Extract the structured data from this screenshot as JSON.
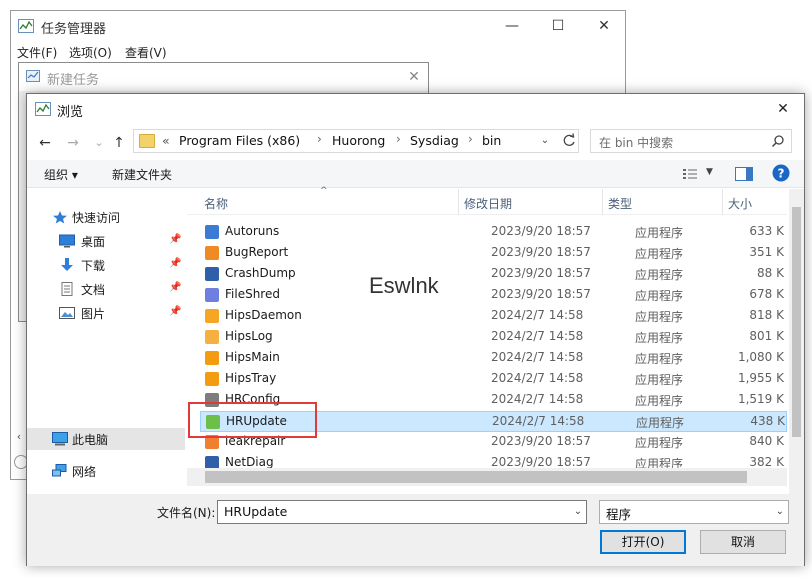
{
  "task_manager": {
    "title": "任务管理器",
    "menu": [
      "文件(F)",
      "选项(O)",
      "查看(V)"
    ],
    "minimize": "—",
    "maximize": "☐",
    "close": "✕"
  },
  "new_task": {
    "title": "新建任务",
    "close": "✕"
  },
  "browse": {
    "title": "浏览",
    "close": "✕",
    "nav": {
      "back": "←",
      "forward": "→",
      "recent": "⌄",
      "up": "↑"
    },
    "address": {
      "prefix": "«",
      "crumbs": [
        "Program Files (x86)",
        "Huorong",
        "Sysdiag",
        "bin"
      ],
      "separator": "›",
      "dropdown": "⌄"
    },
    "search_placeholder": "在 bin 中搜索",
    "toolbar": {
      "organize": "组织 ▾",
      "new_folder": "新建文件夹"
    },
    "nav_pane": [
      {
        "label": "快速访问",
        "icon": "star-icon",
        "pinned": false,
        "selected": false
      },
      {
        "label": "桌面",
        "icon": "desktop-icon",
        "pinned": true,
        "selected": false
      },
      {
        "label": "下载",
        "icon": "download-icon",
        "pinned": true,
        "selected": false
      },
      {
        "label": "文档",
        "icon": "document-icon",
        "pinned": true,
        "selected": false
      },
      {
        "label": "图片",
        "icon": "picture-icon",
        "pinned": true,
        "selected": false
      },
      {
        "label": "此电脑",
        "icon": "computer-icon",
        "pinned": false,
        "selected": true
      },
      {
        "label": "网络",
        "icon": "network-icon",
        "pinned": false,
        "selected": false
      }
    ],
    "columns": {
      "name": "名称",
      "modified": "修改日期",
      "type": "类型",
      "size": "大小"
    },
    "files": [
      {
        "name": "Autoruns",
        "modified": "2023/9/20 18:57",
        "type": "应用程序",
        "size": "633 K",
        "icon": "autoruns-icon",
        "color": "#3b7bd4"
      },
      {
        "name": "BugReport",
        "modified": "2023/9/20 18:57",
        "type": "应用程序",
        "size": "351 K",
        "icon": "bugreport-icon",
        "color": "#f08a24"
      },
      {
        "name": "CrashDump",
        "modified": "2023/9/20 18:57",
        "type": "应用程序",
        "size": "88 K",
        "icon": "crashdump-icon",
        "color": "#2e5fa8"
      },
      {
        "name": "FileShred",
        "modified": "2023/9/20 18:57",
        "type": "应用程序",
        "size": "678 K",
        "icon": "fileshred-icon",
        "color": "#6f7fe0"
      },
      {
        "name": "HipsDaemon",
        "modified": "2024/2/7 14:58",
        "type": "应用程序",
        "size": "818 K",
        "icon": "flame-icon",
        "color": "#f5a623"
      },
      {
        "name": "HipsLog",
        "modified": "2024/2/7 14:58",
        "type": "应用程序",
        "size": "801 K",
        "icon": "hipslog-icon",
        "color": "#f5b041"
      },
      {
        "name": "HipsMain",
        "modified": "2024/2/7 14:58",
        "type": "应用程序",
        "size": "1,080 K",
        "icon": "flame-icon",
        "color": "#f39c12"
      },
      {
        "name": "HipsTray",
        "modified": "2024/2/7 14:58",
        "type": "应用程序",
        "size": "1,955 K",
        "icon": "flame-icon",
        "color": "#f39c12"
      },
      {
        "name": "HRConfig",
        "modified": "2024/2/7 14:58",
        "type": "应用程序",
        "size": "1,519 K",
        "icon": "gear-icon",
        "color": "#7d7d7d"
      },
      {
        "name": "HRUpdate",
        "modified": "2024/2/7 14:58",
        "type": "应用程序",
        "size": "438 K",
        "icon": "update-icon",
        "color": "#6cc04a"
      },
      {
        "name": "leakrepair",
        "modified": "2023/9/20 18:57",
        "type": "应用程序",
        "size": "840 K",
        "icon": "leakrepair-icon",
        "color": "#f07f2e"
      },
      {
        "name": "NetDiag",
        "modified": "2023/9/20 18:57",
        "type": "应用程序",
        "size": "382 K",
        "icon": "netdiag-icon",
        "color": "#2e5fa8"
      }
    ],
    "selected_file": "HRUpdate",
    "filename_label": "文件名(N):",
    "filename_value": "HRUpdate",
    "filetype_value": "程序",
    "open_button": "打开(O)",
    "cancel_button": "取消",
    "help": "?"
  },
  "watermark": "Eswlnk",
  "colors": {
    "selection": "#cce8ff",
    "highlight_box": "#e03a3a",
    "accent": "#0078d7"
  }
}
